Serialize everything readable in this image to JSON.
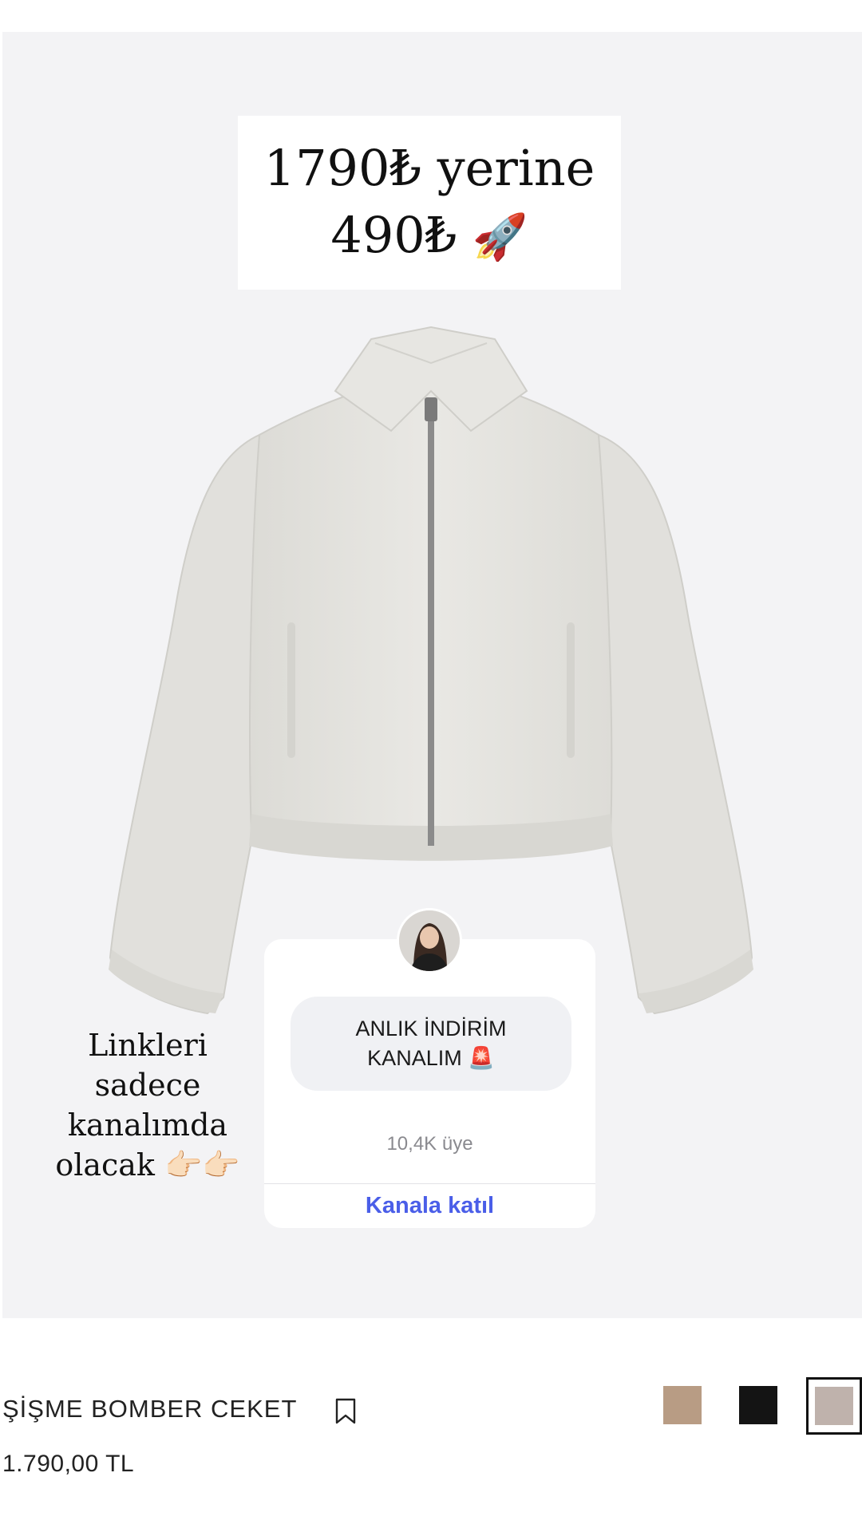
{
  "promo": {
    "line1": "1790₺ yerine",
    "line2": "490₺",
    "rocket": "🚀"
  },
  "note": {
    "text": "Linkleri sadece kanalımda olacak 👉🏻👉🏻"
  },
  "channel": {
    "name": "ANLIK İNDİRİM\nKANALIM 🚨",
    "members": "10,4K üye",
    "join_label": "Kanala katıl"
  },
  "product": {
    "name": "ŞİŞME BOMBER CEKET",
    "price": "1.790,00 TL"
  },
  "swatches": [
    {
      "color": "#b89c84",
      "selected": false
    },
    {
      "color": "#141414",
      "selected": false
    },
    {
      "color": "#bfb2ac",
      "selected": true
    }
  ],
  "colors": {
    "accent": "#4a5ee8",
    "hero_bg": "#f3f3f5",
    "jacket": "#e4e3df"
  }
}
